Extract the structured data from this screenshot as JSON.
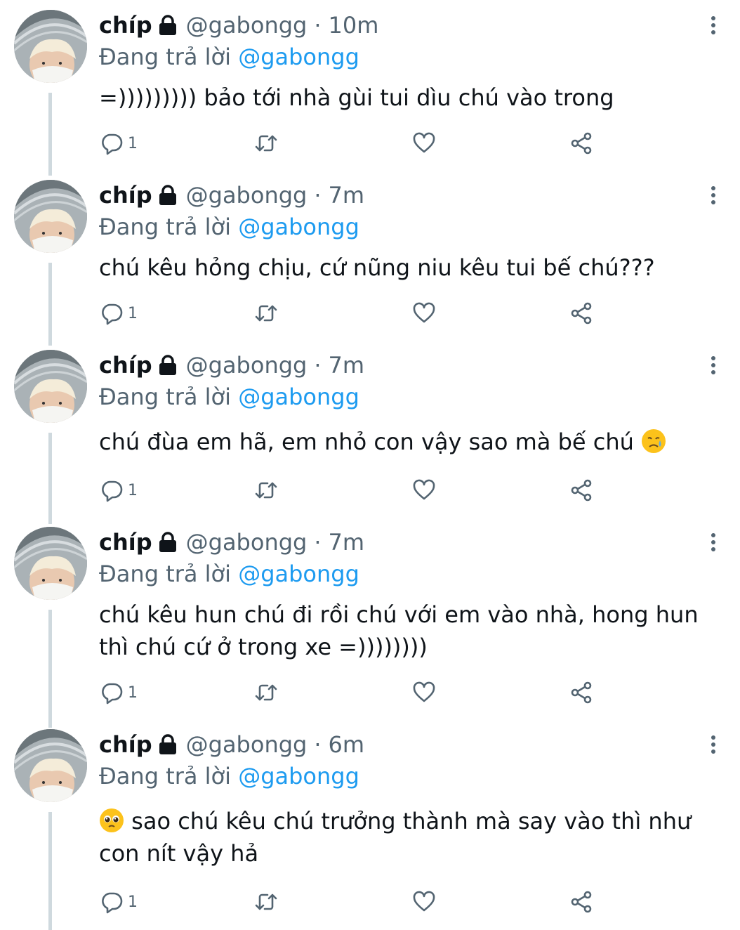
{
  "tweets": [
    {
      "name": "chíp",
      "handle": "@gabongg",
      "separator": "·",
      "time": "10m",
      "replying_label": "Đang trả lời",
      "replying_to": "@gabongg",
      "text_before": "=))))))))) bảo tới nhà gùi tui dìu chú vào trong",
      "text_after": "",
      "emoji": "",
      "reply_count": "1"
    },
    {
      "name": "chíp",
      "handle": "@gabongg",
      "separator": "·",
      "time": "7m",
      "replying_label": "Đang trả lời",
      "replying_to": "@gabongg",
      "text_before": "chú kêu hỏng chịu, cứ nũng niu kêu tui bế chú???",
      "text_after": "",
      "emoji": "",
      "reply_count": "1"
    },
    {
      "name": "chíp",
      "handle": "@gabongg",
      "separator": "·",
      "time": "7m",
      "replying_label": "Đang trả lời",
      "replying_to": "@gabongg",
      "text_before": "chú đùa em hã, em nhỏ con vậy sao mà bế chú ",
      "text_after": "",
      "emoji": "crying-face-emoji",
      "reply_count": "1"
    },
    {
      "name": "chíp",
      "handle": "@gabongg",
      "separator": "·",
      "time": "7m",
      "replying_label": "Đang trả lời",
      "replying_to": "@gabongg",
      "text_before": "chú kêu hun chú đi rồi chú với em vào nhà, hong hun thì chú cứ ở trong xe =))))))))",
      "text_after": "",
      "emoji": "",
      "reply_count": "1"
    },
    {
      "name": "chíp",
      "handle": "@gabongg",
      "separator": "·",
      "time": "6m",
      "replying_label": "Đang trả lời",
      "replying_to": "@gabongg",
      "text_before": "",
      "text_after": " sao chú kêu chú trưởng thành mà say vào thì như con nít vậy hả",
      "emoji": "pleading-face-emoji",
      "reply_count": "1"
    }
  ],
  "colors": {
    "text": "#0f1419",
    "secondary": "#536471",
    "accent": "#1d9bf0",
    "thread_line": "#cfd9de"
  },
  "icons": [
    "lock-icon",
    "more-icon",
    "reply-icon",
    "retweet-icon",
    "like-icon",
    "share-icon"
  ]
}
